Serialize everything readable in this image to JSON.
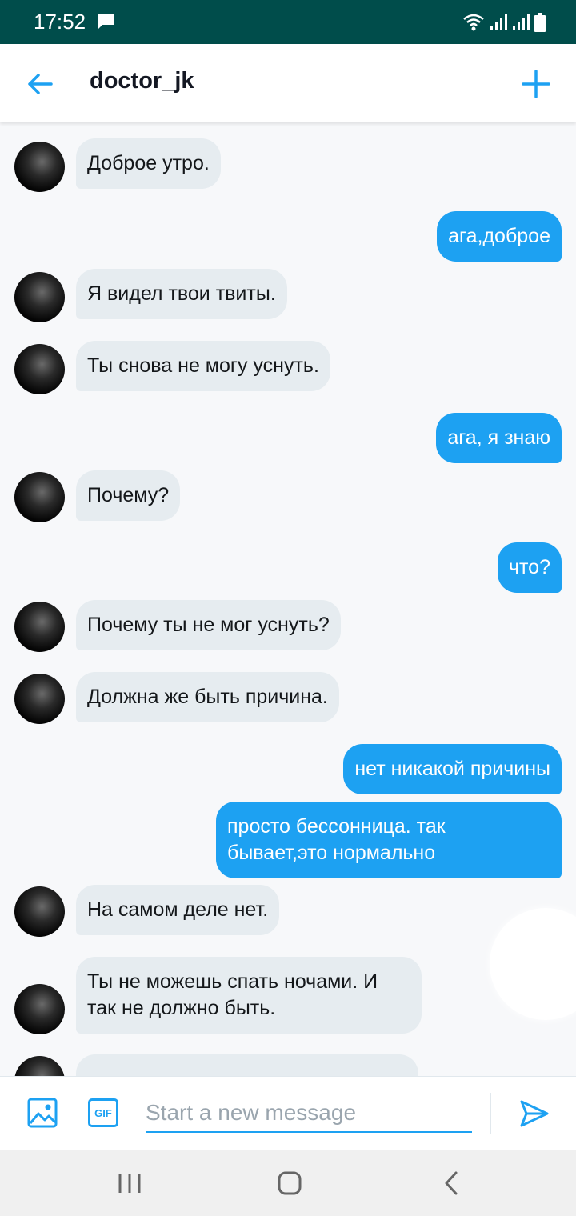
{
  "status_bar": {
    "time": "17:52"
  },
  "header": {
    "title": "doctor_jk"
  },
  "messages": [
    {
      "side": "in",
      "text": "Доброе утро."
    },
    {
      "side": "out",
      "text": "ага,доброе"
    },
    {
      "side": "in",
      "text": "Я видел твои твиты."
    },
    {
      "side": "in",
      "text": "Ты снова не могу уснуть."
    },
    {
      "side": "out",
      "text": "ага, я знаю"
    },
    {
      "side": "in",
      "text": "Почему?"
    },
    {
      "side": "out",
      "text": "что?"
    },
    {
      "side": "in",
      "text": "Почему ты не мог уснуть?"
    },
    {
      "side": "in",
      "text": "Должна же быть причина."
    },
    {
      "side": "out",
      "text": "нет никакой причины"
    },
    {
      "side": "out",
      "text": "просто бессонница. так бывает,это нормально"
    },
    {
      "side": "in",
      "text": "На самом деле нет."
    },
    {
      "side": "in",
      "text": "Ты не можешь спать ночами. И так не должно быть."
    },
    {
      "side": "in",
      "text": ""
    }
  ],
  "composer": {
    "placeholder": "Start a new message",
    "gif_label": "GIF"
  },
  "colors": {
    "accent": "#1da1f2",
    "status_bar": "#004d4b",
    "incoming_bubble": "#e6ecf0"
  }
}
